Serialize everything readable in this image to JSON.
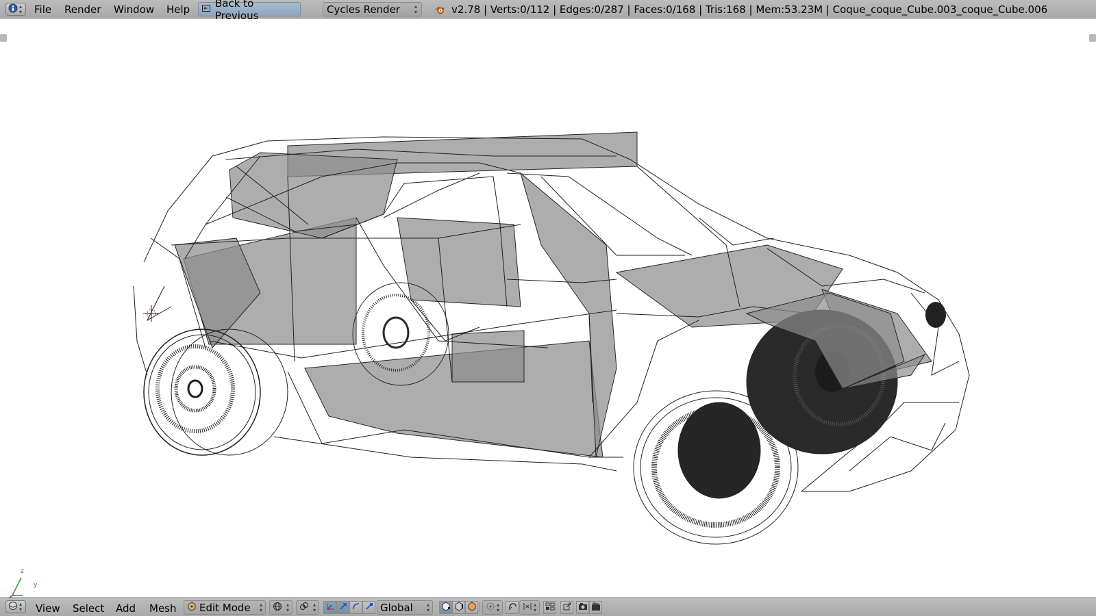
{
  "header": {
    "menus": [
      "File",
      "Render",
      "Window",
      "Help"
    ],
    "back_label": "Back to Previous",
    "engine": "Cycles Render",
    "stats": "v2.78 | Verts:0/112 | Edges:0/287 | Faces:0/168 | Tris:168 | Mem:53.23M | Coque_coque_Cube.003_coque_Cube.006"
  },
  "viewport": {
    "axis_z": "z",
    "axis_y": "y"
  },
  "footer": {
    "menus": [
      "View",
      "Select",
      "Add",
      "Mesh"
    ],
    "mode": "Edit Mode",
    "orientation": "Global"
  },
  "colors": {
    "header_bg": "#aeaeae",
    "back_button": "#9bb0c6",
    "active_toggle": "#7f96ae",
    "mesh_fill": "#8d8d8d",
    "wire": "#1e1e1e"
  },
  "icons": [
    "info-icon",
    "back-arrow-icon",
    "blender-logo-icon",
    "view3d-editor-icon",
    "edit-mode-icon",
    "viewport-shading-icon",
    "pivot-icon",
    "manipulator-icon",
    "translate-icon",
    "rotate-icon",
    "scale-icon",
    "layer-icons",
    "proportional-edit-icon",
    "snap-icon",
    "render-icon"
  ]
}
